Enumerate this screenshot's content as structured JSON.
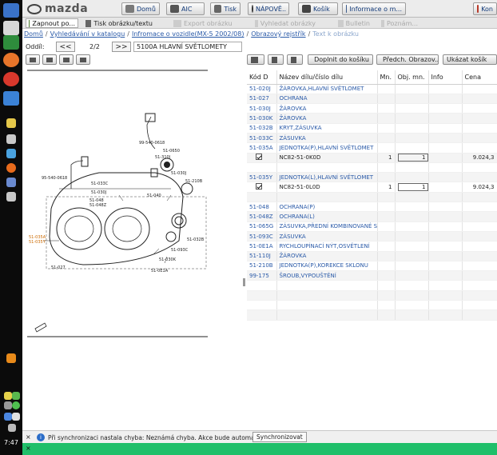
{
  "taskbar": {
    "clock": "7:47"
  },
  "nav": {
    "logo_text": "mazda",
    "buttons": [
      {
        "label": "Domů",
        "icon": "car-icon"
      },
      {
        "label": "AIC",
        "icon": "car-info-icon"
      },
      {
        "label": "Tisk",
        "icon": "printer-icon"
      },
      {
        "label": "NÁPOVĚ..",
        "icon": "help-icon"
      },
      {
        "label": "Košík",
        "icon": "cart-icon"
      },
      {
        "label": "Informace o m...",
        "icon": "vehicle-info-icon"
      },
      {
        "label": "Kon",
        "icon": "exit-icon"
      }
    ]
  },
  "subbar": {
    "tabs": [
      {
        "label": "Zapnout po...",
        "state": "active"
      },
      {
        "label": "Tisk obrázku/textu",
        "state": "normal"
      },
      {
        "label": "Export obrázku",
        "state": "disabled"
      },
      {
        "label": "Vyhledat obrázky",
        "state": "disabled"
      },
      {
        "label": "Bulletin",
        "state": "disabled"
      },
      {
        "label": "Poznám...",
        "state": "disabled"
      }
    ]
  },
  "breadcrumb": {
    "items": [
      "Domů",
      "Vyhledávání v katalogu",
      "Infromace o vozidle(MX-5 2002/08)",
      "Obrazový rejstřík"
    ],
    "current": "Text k obrázku"
  },
  "section": {
    "label": "Oddíl:",
    "prev": "<<",
    "page": "2/2",
    "next": ">>",
    "name": "5100A HLAVNÍ SVĚTLOMETY"
  },
  "diagram": {
    "labels": [
      "99-540-0618",
      "51-0650",
      "51-310J",
      "51-030J",
      "51-210B",
      "95-540-0618",
      "51-033C",
      "51-030J",
      "51-048",
      "51-048Z",
      "51-035A",
      "51-035Y",
      "51-040",
      "51-032B",
      "51-093C",
      "51-030K",
      "51-027",
      "51-0E1A"
    ]
  },
  "right_toolbar": {
    "add_to_cart": "Doplnit do košíku",
    "prev_image": "Předch. Obrazov...",
    "show_cart": "Ukázat košík"
  },
  "table": {
    "headers": [
      "Kód D",
      "Název dílu/číslo dílu",
      "Mn.",
      "Obj. mn.",
      "Info",
      "Cena"
    ],
    "rows": [
      {
        "code": "51-020J",
        "name": "ŽÁROVKA,HLAVNÍ SVĚTLOMET"
      },
      {
        "code": "51-027",
        "name": "OCHRANA"
      },
      {
        "code": "51-030J",
        "name": "ŽÁROVKA"
      },
      {
        "code": "51-030K",
        "name": "ŽÁROVKA"
      },
      {
        "code": "51-032B",
        "name": "KRYT,ZÁSUVKA"
      },
      {
        "code": "51-033C",
        "name": "ZÁSUVKA"
      },
      {
        "code": "51-035A",
        "name": "JEDNOTKA(P),HLAVNÍ SVĚTLOMET"
      },
      {
        "code": "",
        "name": "NC82-51-0K0D",
        "detail": true,
        "qty": "1",
        "order": "1",
        "price": "9.024,3"
      },
      {
        "code": "",
        "name": ""
      },
      {
        "code": "51-035Y",
        "name": "JEDNOTKA(L),HLAVNÍ SVĚTLOMET"
      },
      {
        "code": "",
        "name": "NC82-51-0L0D",
        "detail": true,
        "qty": "1",
        "order": "1",
        "price": "9.024,3"
      },
      {
        "code": "",
        "name": ""
      },
      {
        "code": "51-048",
        "name": "OCHRANA(P)"
      },
      {
        "code": "51-048Z",
        "name": "OCHRANA(L)"
      },
      {
        "code": "51-065G",
        "name": "ZÁSUVKA,PŘEDNÍ KOMBINOVANÉ SV."
      },
      {
        "code": "51-093C",
        "name": "ZÁSUVKA"
      },
      {
        "code": "51-0E1A",
        "name": "RYCHLOUPÍNACÍ NÝT,OSVĚTLENÍ"
      },
      {
        "code": "51-110J",
        "name": "ŽÁROVKA"
      },
      {
        "code": "51-210B",
        "name": "JEDNOTKA(P),KOREKCE SKLONU"
      },
      {
        "code": "99-175",
        "name": "ŠROUB,VYPOUŠTĚNÍ"
      },
      {
        "code": "",
        "name": ""
      },
      {
        "code": "",
        "name": ""
      },
      {
        "code": "",
        "name": ""
      },
      {
        "code": "",
        "name": ""
      }
    ]
  },
  "status": {
    "close": "×",
    "message": "Při synchronizaci nastala chyba: Neznámá chyba. Akce bude automaticky opakována.",
    "button": "Synchronizovat"
  },
  "greenbar": {
    "close": "×"
  }
}
